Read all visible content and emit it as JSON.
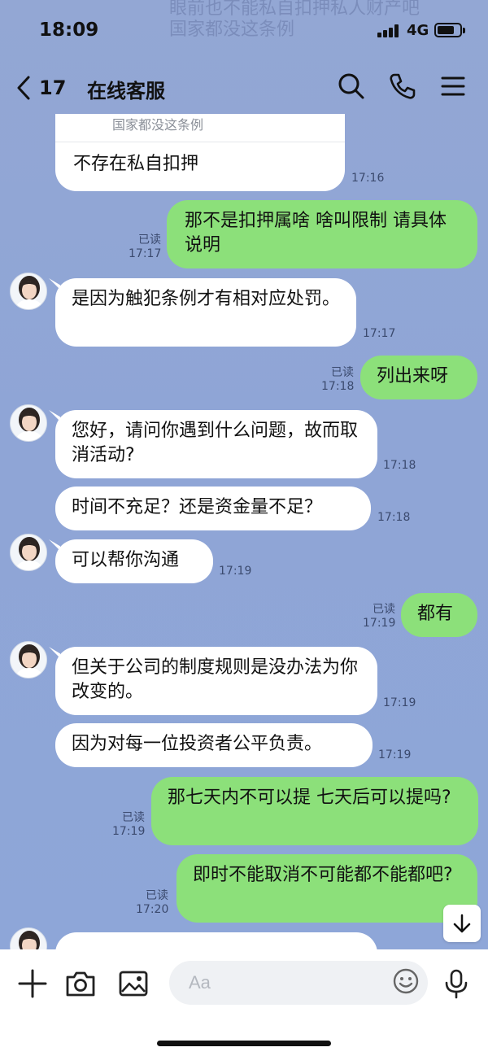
{
  "status_bar": {
    "time": "18:09",
    "network": "4G",
    "battery_level": 0.75
  },
  "header": {
    "back_count": "17",
    "title": "在线客服"
  },
  "ghost_text": {
    "line1": "眼前也不能私自扣押私人财产吧",
    "line2": "国家都没这条例"
  },
  "messages": {
    "m0": {
      "quote": "国家都没这条例",
      "text": "不存在私自扣押",
      "time": "17:16"
    },
    "m1": {
      "text": "那不是扣押属啥 啥叫限制 请具体说明",
      "read": "已读",
      "time": "17:17"
    },
    "m2": {
      "text": "是因为触犯条例才有相对应处罚。",
      "time": "17:17"
    },
    "m3": {
      "text": "列出来呀",
      "read": "已读",
      "time": "17:18"
    },
    "m4": {
      "text": "您好，请问你遇到什么问题，故而取消活动?",
      "time": "17:18"
    },
    "m5": {
      "text": "时间不充足？还是资金量不足？",
      "time": "17:18"
    },
    "m6": {
      "text": "可以帮你沟通",
      "time": "17:19"
    },
    "m7": {
      "text": "都有",
      "read": "已读",
      "time": "17:19"
    },
    "m8": {
      "text": "但关于公司的制度规则是没办法为你改变的。",
      "time": "17:19"
    },
    "m9": {
      "text": "因为对每一位投资者公平负责。",
      "time": "17:19"
    },
    "m10": {
      "text": "那七天内不可以提 七天后可以提吗?",
      "read": "已读",
      "time": "17:19"
    },
    "m11": {
      "text": "即时不能取消不可能都不能都吧?",
      "read": "已读",
      "time": "17:20"
    }
  },
  "input": {
    "placeholder": "Aa"
  },
  "colors": {
    "background": "#8fa5d6",
    "outgoing_bubble": "#8ce07a",
    "incoming_bubble": "#ffffff"
  },
  "icons": [
    "back-chevron-icon",
    "search-icon",
    "phone-icon",
    "menu-icon",
    "plus-icon",
    "camera-icon",
    "image-icon",
    "emoji-icon",
    "microphone-icon",
    "arrow-down-icon"
  ]
}
